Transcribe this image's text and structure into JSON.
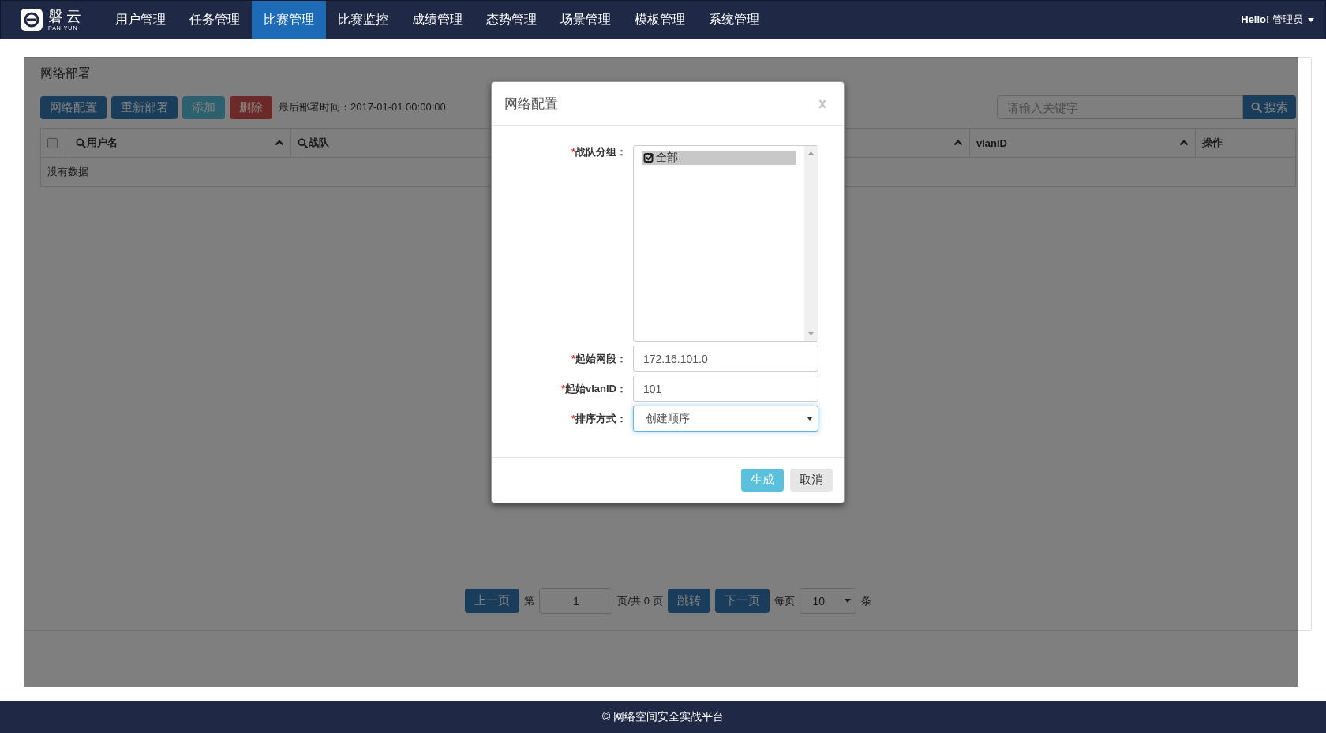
{
  "navbar": {
    "logo": {
      "name": "磐云",
      "subtitle": "PAN YUN"
    },
    "items": [
      {
        "label": "用户管理",
        "selected": false
      },
      {
        "label": "任务管理",
        "selected": false
      },
      {
        "label": "比赛管理",
        "selected": true
      },
      {
        "label": "比赛监控",
        "selected": false
      },
      {
        "label": "成绩管理",
        "selected": false
      },
      {
        "label": "态势管理",
        "selected": false
      },
      {
        "label": "场景管理",
        "selected": false
      },
      {
        "label": "模板管理",
        "selected": false
      },
      {
        "label": "系统管理",
        "selected": false
      }
    ],
    "user": "**Hello!** 管理员"
  },
  "panel": {
    "title": "网络部署",
    "toolbar": [
      {
        "label": "网络配置",
        "kind": "primary"
      },
      {
        "label": "重新部署",
        "kind": "primary"
      },
      {
        "label": "添加",
        "kind": "info"
      },
      {
        "label": "删除",
        "kind": "danger"
      }
    ],
    "last_deploy": "最后部署时间：2017-01-01 00:00:00",
    "search": {
      "placeholder": "请输入关键字",
      "button": "搜索"
    },
    "table": {
      "select_all": {
        "checked": false
      },
      "columns": [
        {
          "label": "用户名",
          "searchable": true,
          "sortable": true
        },
        {
          "label": "战队",
          "searchable": true,
          "sortable": false
        },
        {
          "searchable": false,
          "sortable": true
        },
        {
          "label": "vlanID",
          "searchable": false,
          "sortable": true
        },
        {
          "label": "操作",
          "searchable": false,
          "sortable": false
        }
      ],
      "empty_message": "没有数据"
    },
    "pagination": {
      "prev": "上一页",
      "page_prefix": "第",
      "page": "1",
      "page_suffix": "页/共 0 页",
      "jump": "跳转",
      "next": "下一页",
      "per_page_prefix": "每页",
      "per_page": "10",
      "per_page_suffix": "条"
    }
  },
  "modal": {
    "title": "网络配置",
    "close": "x",
    "fields": [
      {
        "label": "战队分组：",
        "required_mark": "*",
        "kind": "listbox",
        "options": [
          {
            "label": "全部",
            "selected": true,
            "checked": true
          }
        ]
      },
      {
        "label": "起始网段：",
        "required_mark": "*",
        "kind": "text",
        "value": "172.16.101.0"
      },
      {
        "label": "起始vlanID：",
        "required_mark": "*",
        "kind": "text",
        "value": "101"
      },
      {
        "label": "排序方式：",
        "required_mark": "*",
        "kind": "select",
        "value": "创建顺序",
        "focused": true
      }
    ],
    "buttons": [
      {
        "label": "生成",
        "kind": "info"
      },
      {
        "label": "取消",
        "kind": "default"
      }
    ]
  },
  "footer": "© 网络空间安全实战平台"
}
